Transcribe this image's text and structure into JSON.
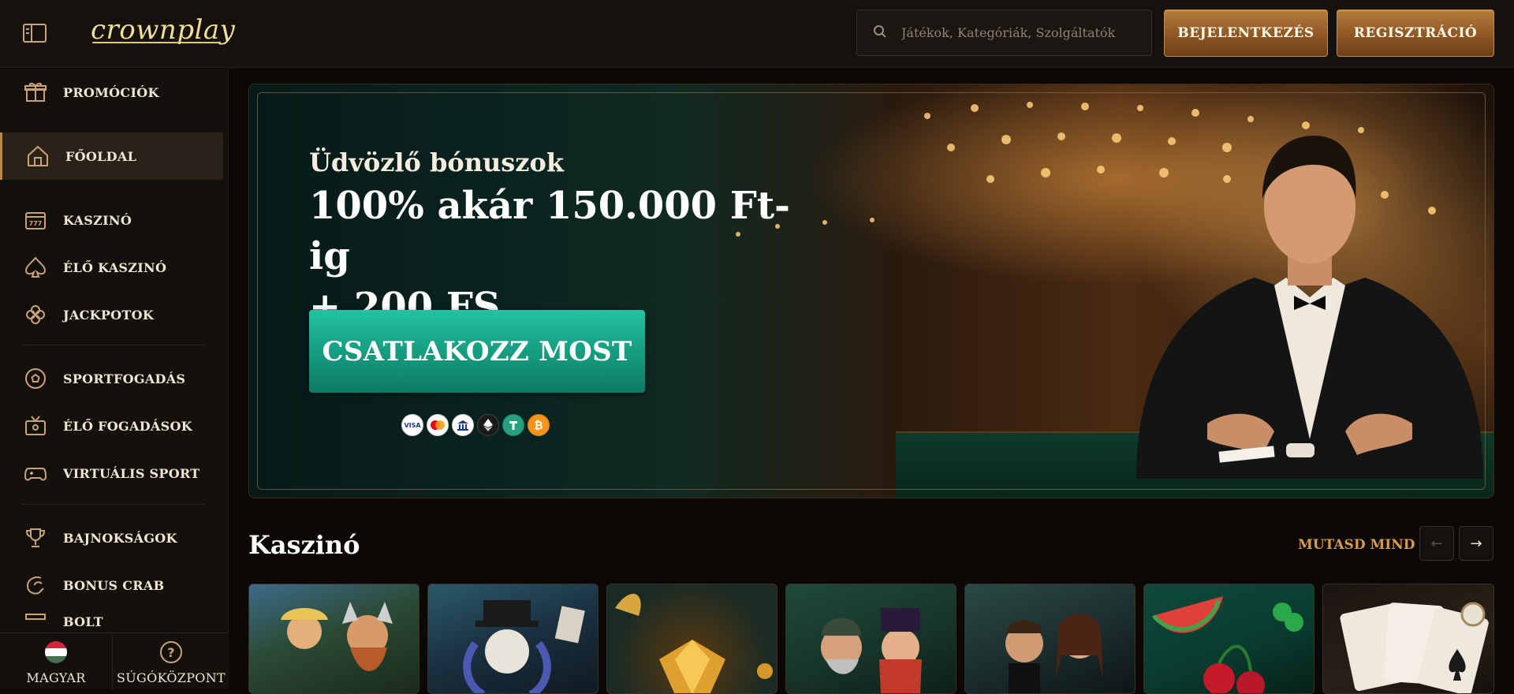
{
  "header": {
    "logo_text": "crownplay",
    "search_placeholder": "Játékok, Kategóriák, Szolgáltatók",
    "login_label": "BEJELENTKEZÉS",
    "register_label": "REGISZTRÁCIÓ"
  },
  "sidebar": {
    "items": [
      {
        "label": "PROMÓCIÓK",
        "icon": "gift-icon"
      },
      {
        "label": "FŐOLDAL",
        "icon": "home-icon",
        "active": true
      },
      {
        "label": "KASZINÓ",
        "icon": "slot-machine-icon"
      },
      {
        "label": "ÉLŐ KASZINÓ",
        "icon": "spade-icon"
      },
      {
        "label": "JACKPOTOK",
        "icon": "clover-icon"
      },
      {
        "label": "SPORTFOGADÁS",
        "icon": "soccer-ball-icon"
      },
      {
        "label": "ÉLŐ FOGADÁSOK",
        "icon": "live-tv-icon"
      },
      {
        "label": "VIRTUÁLIS SPORT",
        "icon": "gamepad-icon"
      },
      {
        "label": "BAJNOKSÁGOK",
        "icon": "trophy-icon"
      },
      {
        "label": "BONUS CRAB",
        "icon": "claw-icon"
      },
      {
        "label": "BOLT",
        "icon": "shop-icon"
      }
    ],
    "language_label": "MAGYAR",
    "help_label": "SÚGÓKÖZPONT"
  },
  "banner": {
    "subtitle": "Üdvözlő bónuszok",
    "title_line1": "100% akár 150.000 Ft-ig",
    "title_line2": "+ 200 FS",
    "cta_label": "CSATLAKOZZ MOST",
    "payment_icons": [
      "visa-icon",
      "mastercard-icon",
      "bank-icon",
      "ethereum-icon",
      "tether-icon",
      "bitcoin-icon"
    ],
    "visa_text": "VISA"
  },
  "section": {
    "title": "Kaszinó",
    "show_all": "MUTASD MIND"
  },
  "colors": {
    "accent_gold": "#b57c3b",
    "cta_green": "#159a7e",
    "show_all": "#d99a4a",
    "background": "#0b0806"
  }
}
